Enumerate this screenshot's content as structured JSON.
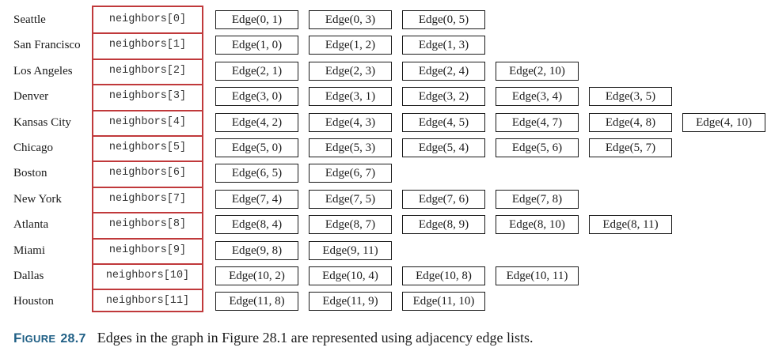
{
  "rows": [
    {
      "city": "Seattle",
      "neighbors": "neighbors[0]",
      "edges": [
        "Edge(0, 1)",
        "Edge(0, 3)",
        "Edge(0, 5)"
      ]
    },
    {
      "city": "San Francisco",
      "neighbors": "neighbors[1]",
      "edges": [
        "Edge(1, 0)",
        "Edge(1, 2)",
        "Edge(1, 3)"
      ]
    },
    {
      "city": "Los Angeles",
      "neighbors": "neighbors[2]",
      "edges": [
        "Edge(2, 1)",
        "Edge(2, 3)",
        "Edge(2, 4)",
        "Edge(2, 10)"
      ]
    },
    {
      "city": "Denver",
      "neighbors": "neighbors[3]",
      "edges": [
        "Edge(3, 0)",
        "Edge(3, 1)",
        "Edge(3, 2)",
        "Edge(3, 4)",
        "Edge(3, 5)"
      ]
    },
    {
      "city": "Kansas City",
      "neighbors": "neighbors[4]",
      "edges": [
        "Edge(4, 2)",
        "Edge(4, 3)",
        "Edge(4, 5)",
        "Edge(4, 7)",
        "Edge(4, 8)",
        "Edge(4, 10)"
      ]
    },
    {
      "city": "Chicago",
      "neighbors": "neighbors[5]",
      "edges": [
        "Edge(5, 0)",
        "Edge(5, 3)",
        "Edge(5, 4)",
        "Edge(5, 6)",
        "Edge(5, 7)"
      ]
    },
    {
      "city": "Boston",
      "neighbors": "neighbors[6]",
      "edges": [
        "Edge(6, 5)",
        "Edge(6, 7)"
      ]
    },
    {
      "city": "New York",
      "neighbors": "neighbors[7]",
      "edges": [
        "Edge(7, 4)",
        "Edge(7, 5)",
        "Edge(7, 6)",
        "Edge(7, 8)"
      ]
    },
    {
      "city": "Atlanta",
      "neighbors": "neighbors[8]",
      "edges": [
        "Edge(8, 4)",
        "Edge(8, 7)",
        "Edge(8, 9)",
        "Edge(8, 10)",
        "Edge(8, 11)"
      ]
    },
    {
      "city": "Miami",
      "neighbors": "neighbors[9]",
      "edges": [
        "Edge(9, 8)",
        "Edge(9, 11)"
      ]
    },
    {
      "city": "Dallas",
      "neighbors": "neighbors[10]",
      "edges": [
        "Edge(10, 2)",
        "Edge(10, 4)",
        "Edge(10, 8)",
        "Edge(10, 11)"
      ]
    },
    {
      "city": "Houston",
      "neighbors": "neighbors[11]",
      "edges": [
        "Edge(11, 8)",
        "Edge(11, 9)",
        "Edge(11, 10)"
      ]
    }
  ],
  "caption": {
    "label": "FIGURE",
    "number": "28.7",
    "text": "Edges in the graph in Figure 28.1 are represented using adjacency edge lists."
  },
  "colors": {
    "neighbors_border": "#c0393b",
    "figure_label": "#1f5f85"
  }
}
